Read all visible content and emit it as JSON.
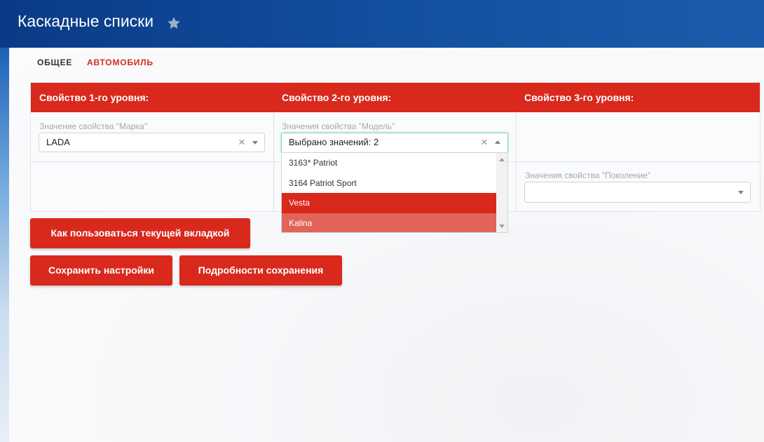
{
  "header": {
    "title": "Каскадные списки",
    "favorite_icon": "star-icon"
  },
  "tabs": [
    {
      "label": "ОБЩЕЕ",
      "active": false
    },
    {
      "label": "АВТОМОБИЛЬ",
      "active": true
    }
  ],
  "grid": {
    "columns": [
      "Свойство 1-го уровня:",
      "Свойство 2-го уровня:",
      "Свойство 3-го уровня:"
    ],
    "level1": {
      "label": "Значение свойства \"Марка\"",
      "value": "LADA"
    },
    "level2": {
      "label": "Значения свойства \"Модель\"",
      "value": "Выбрано значений: 2",
      "options": [
        {
          "label": "3163* Patriot",
          "state": "normal"
        },
        {
          "label": "3164 Patriot Sport",
          "state": "normal"
        },
        {
          "label": "Vesta",
          "state": "selected"
        },
        {
          "label": "Kalina",
          "state": "highlighted"
        }
      ]
    },
    "level3": {
      "label": "Значения свойства \"Поколение\"",
      "value": ""
    }
  },
  "buttons": {
    "help": "Как пользоваться текущей вкладкой",
    "save": "Сохранить настройки",
    "details": "Подробности сохранения"
  },
  "colors": {
    "accent": "#d9291d",
    "header_bg": "#0a3a86"
  }
}
